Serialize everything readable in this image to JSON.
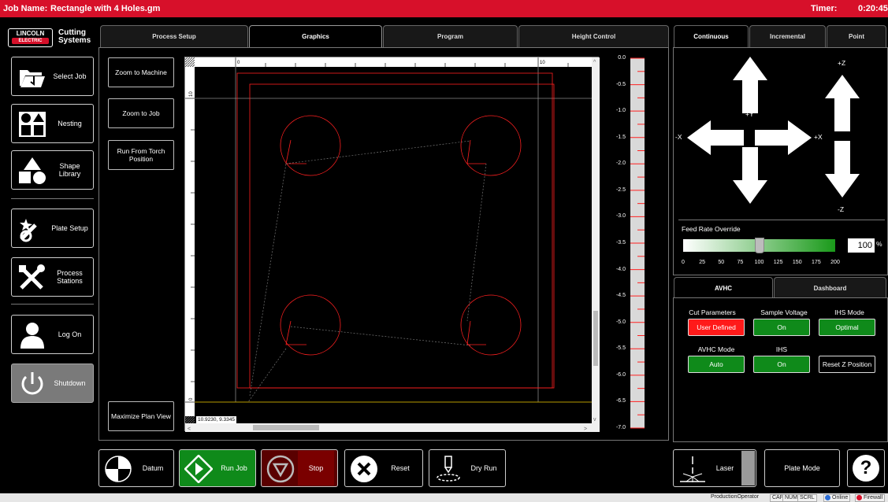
{
  "header": {
    "job_label": "Job Name:",
    "job_name": "Rectangle with 4 Holes.gm",
    "timer_label": "Timer:",
    "timer_value": "0:20:45"
  },
  "logo": {
    "brand_top": "LINCOLN",
    "brand_bottom": "ELECTRIC",
    "product_line1": "Cutting",
    "product_line2": "Systems"
  },
  "sidebar": {
    "items": [
      {
        "label": "Select Job",
        "icon": "folder-open-icon"
      },
      {
        "label": "Nesting",
        "icon": "nesting-icon"
      },
      {
        "label": "Shape Library",
        "icon": "shapes-icon"
      },
      {
        "label": "Plate Setup",
        "icon": "plate-setup-icon"
      },
      {
        "label": "Process Stations",
        "icon": "tools-icon"
      },
      {
        "label": "Log On",
        "icon": "user-icon"
      },
      {
        "label": "Shutdown",
        "icon": "power-icon"
      }
    ]
  },
  "tabs": [
    {
      "label": "Process Setup",
      "active": false
    },
    {
      "label": "Graphics",
      "active": true
    },
    {
      "label": "Program",
      "active": false
    },
    {
      "label": "Height Control",
      "active": false
    }
  ],
  "graphics": {
    "zoom_to_machine": "Zoom to Machine",
    "zoom_to_job": "Zoom to Job",
    "run_from_torch": "Run From Torch Position",
    "maximize": "Maximize Plan View",
    "coords": "10.9230, 9.3345",
    "ruler_top": [
      "0",
      "10"
    ],
    "ruler_left": [
      "10",
      "0"
    ]
  },
  "height_scale": {
    "labels": [
      "0.0",
      "-0.5",
      "-1.0",
      "-1.5",
      "-2.0",
      "-2.5",
      "-3.0",
      "-3.5",
      "-4.0",
      "-4.5",
      "-5.0",
      "-5.5",
      "-6.0",
      "-6.5",
      "-7.0"
    ]
  },
  "jog": {
    "tabs": [
      {
        "label": "Continuous",
        "active": true
      },
      {
        "label": "Incremental",
        "active": false
      },
      {
        "label": "Point",
        "active": false
      }
    ],
    "labels": {
      "py": "+Y",
      "ny": "-Y",
      "px": "+X",
      "nx": "-X",
      "pz": "+Z",
      "nz": "-Z"
    },
    "feed_rate_label": "Feed Rate Override",
    "feed_rate_value": "100",
    "feed_rate_unit": "%",
    "feed_rate_fraction": 0.5,
    "feed_ticks": [
      "0",
      "25",
      "50",
      "75",
      "100",
      "125",
      "150",
      "175",
      "200"
    ]
  },
  "avhc": {
    "tabs": [
      {
        "label": "AVHC",
        "active": true
      },
      {
        "label": "Dashboard",
        "active": false
      }
    ],
    "cut_params_label": "Cut Parameters",
    "cut_params_value": "User Defined",
    "sample_voltage_label": "Sample Voltage",
    "sample_voltage_value": "On",
    "ihs_mode_label": "IHS Mode",
    "ihs_mode_value": "Optimal",
    "avhc_mode_label": "AVHC Mode",
    "avhc_mode_value": "Auto",
    "ihs_label": "IHS",
    "ihs_value": "On",
    "reset_z": "Reset Z Position"
  },
  "bottom": {
    "datum": "Datum",
    "run_job": "Run Job",
    "stop": "Stop",
    "reset": "Reset",
    "dry_run": "Dry Run",
    "laser": "Laser",
    "plate_mode": "Plate Mode",
    "help": "?"
  },
  "statusbar": {
    "user": "ProductionOperator",
    "cap": "CAP",
    "num": "NUM",
    "scrl": "SCRL",
    "online": "Online",
    "firewall": "Firewall"
  },
  "colors": {
    "brand_red": "#d7102a",
    "green": "#0f8a1a",
    "stop_red": "#7a0000",
    "cut_red": "#ff2020"
  }
}
